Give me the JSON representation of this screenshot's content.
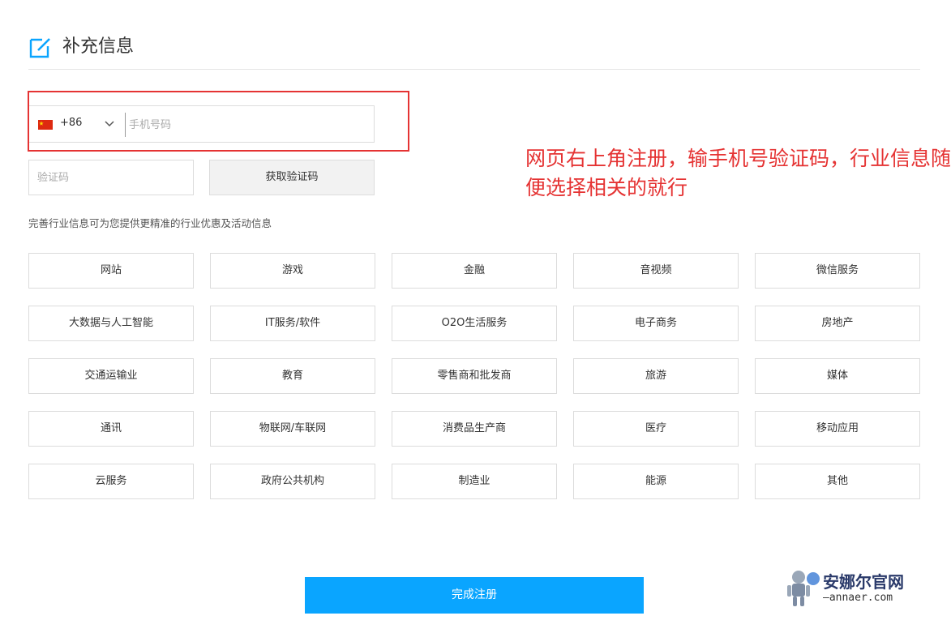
{
  "header": {
    "title": "补充信息"
  },
  "phone": {
    "country_code": "+86",
    "placeholder": "手机号码"
  },
  "verify": {
    "code_placeholder": "验证码",
    "get_code_label": "获取验证码"
  },
  "annotation": {
    "text": "网页右上角注册，输手机号验证码，行业信息随便选择相关的就行"
  },
  "hint": "完善行业信息可为您提供更精准的行业优惠及活动信息",
  "industries": [
    "网站",
    "游戏",
    "金融",
    "音视频",
    "微信服务",
    "大数据与人工智能",
    "IT服务/软件",
    "O2O生活服务",
    "电子商务",
    "房地产",
    "交通运输业",
    "教育",
    "零售商和批发商",
    "旅游",
    "媒体",
    "通讯",
    "物联网/车联网",
    "消费品生产商",
    "医疗",
    "移动应用",
    "云服务",
    "政府公共机构",
    "制造业",
    "能源",
    "其他"
  ],
  "submit_label": "完成注册",
  "watermark": {
    "name": "安娜尔官网",
    "url": "—annaer.com"
  },
  "colors": {
    "accent": "#0aa5ff",
    "highlight": "#e53333",
    "border": "#dcdcdc"
  },
  "icons": {
    "header": "edit-icon",
    "flag": "china-flag-icon",
    "dropdown": "chevron-down-icon"
  }
}
